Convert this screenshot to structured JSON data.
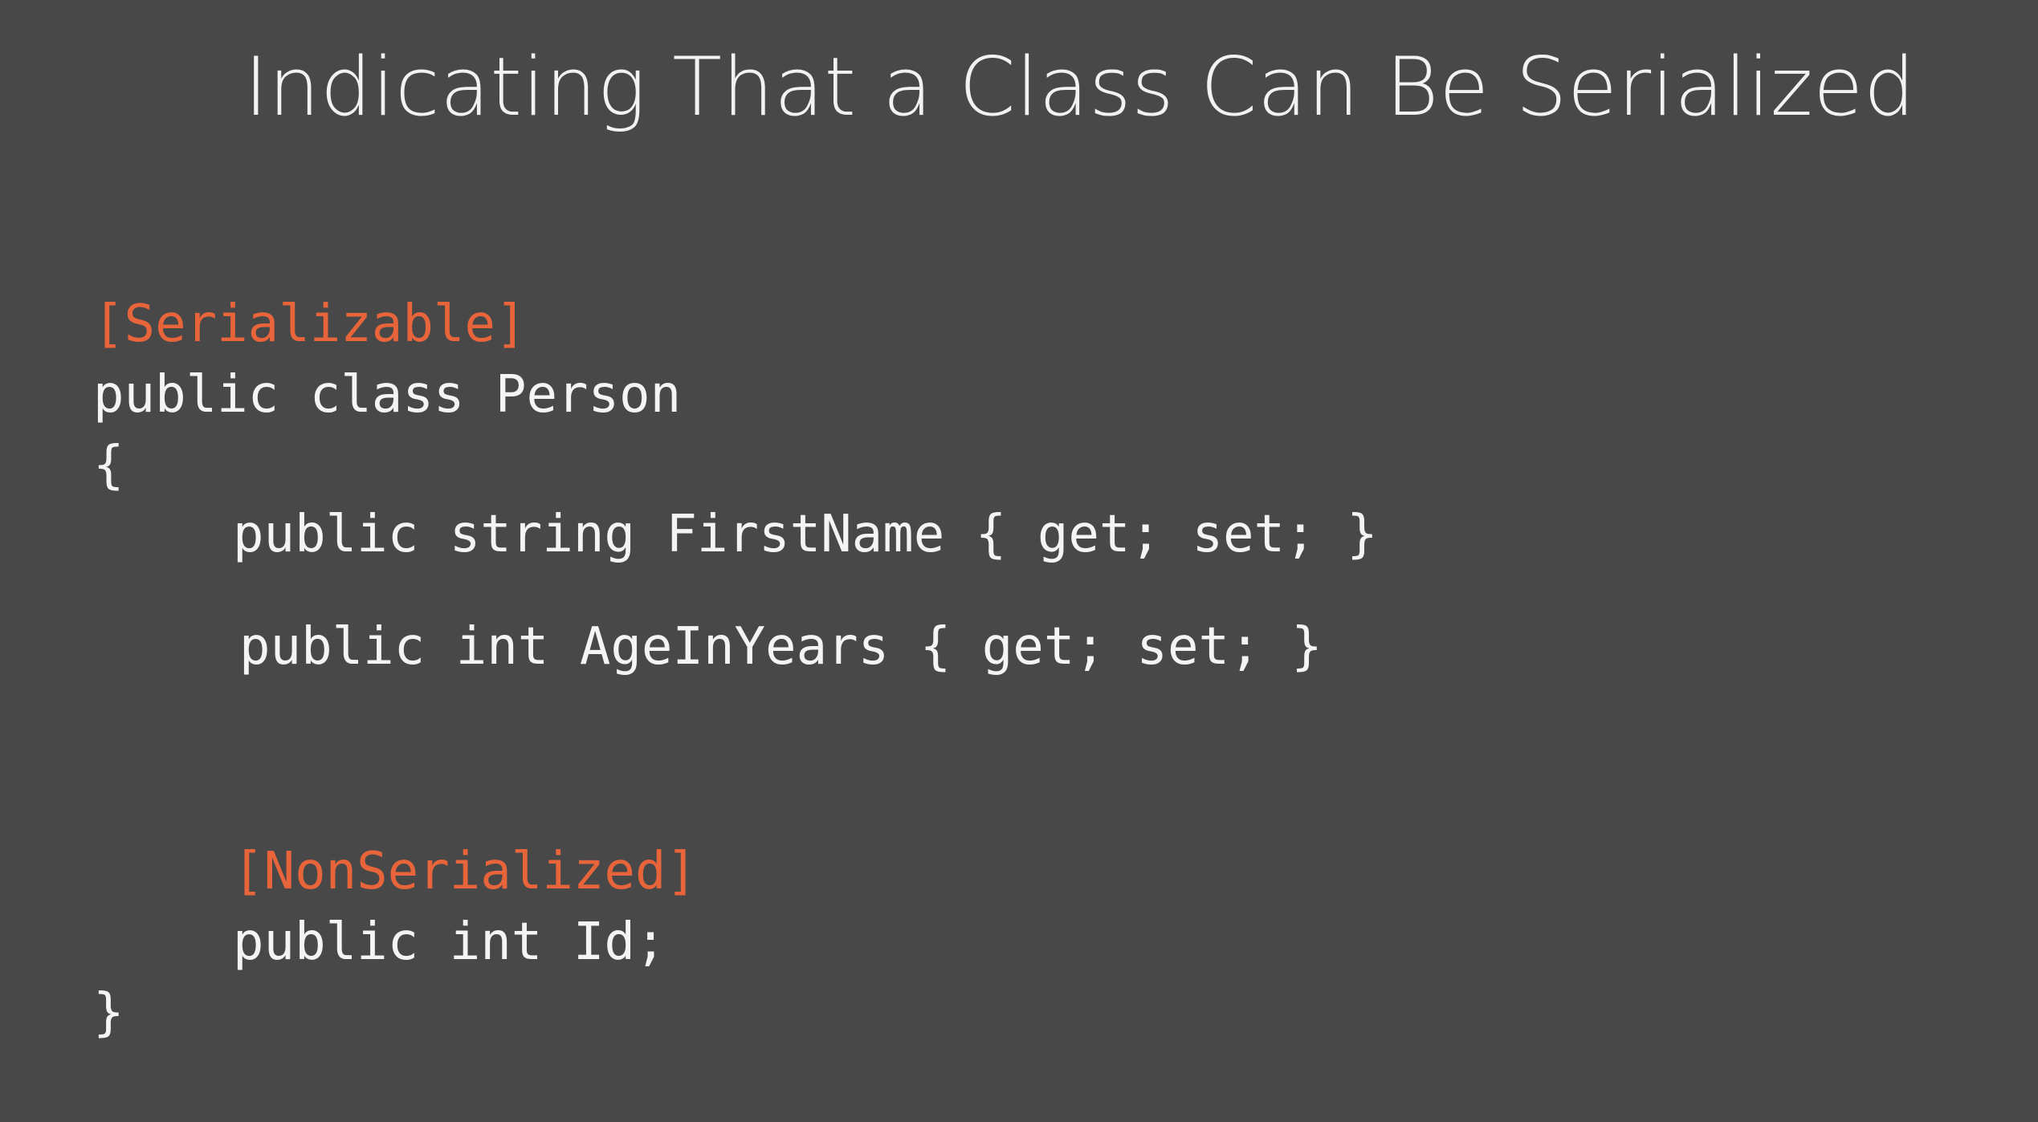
{
  "title": "Indicating That a Class Can Be Serialized",
  "code": {
    "attr_serializable": "[Serializable]",
    "class_decl": "public class Person",
    "open_brace": "{",
    "prop_firstname": "public string FirstName { get; set; }",
    "prop_age": "public int AgeInYears { get; set; }",
    "attr_nonserialized": "[NonSerialized]",
    "field_id": "public int Id;",
    "close_brace": "}"
  },
  "colors": {
    "background": "#484848",
    "text": "#f4f4f4",
    "attribute": "#e8643a"
  }
}
